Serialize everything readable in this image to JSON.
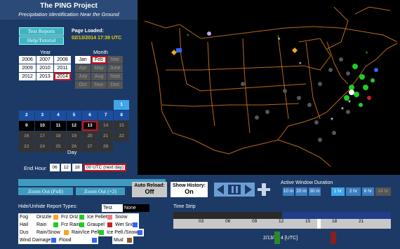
{
  "header": {
    "title": "The PING Project",
    "subtitle": "Precipitation Identification Near the Ground"
  },
  "links": {
    "text_reports": "Text Reports",
    "help": "Help/Tutorial"
  },
  "page_loaded": {
    "label": "Page Loaded:",
    "value": "02/13/2014 17:39 UTC"
  },
  "year_label": "Year",
  "month_label": "Month",
  "years": [
    "2006",
    "2007",
    "2008",
    "2009",
    "2010",
    "2011",
    "2012",
    "2013",
    "2014"
  ],
  "months": [
    "Jan",
    "Feb",
    "Mar",
    "Apr",
    "May",
    "June",
    "July",
    "Aug",
    "Sept",
    "Oct",
    "Nov",
    "Dec"
  ],
  "calendar": {
    "rows": [
      [
        "",
        "",
        "",
        "",
        "",
        "",
        "1"
      ],
      [
        "2",
        "3",
        "4",
        "5",
        "6",
        "7",
        "8"
      ],
      [
        "9",
        "10",
        "11",
        "12",
        "13",
        "14",
        "15"
      ],
      [
        "16",
        "17",
        "18",
        "19",
        "20",
        "21",
        "22"
      ],
      [
        "23",
        "24",
        "25",
        "26",
        "27",
        "28",
        ""
      ]
    ],
    "day_label": "Day"
  },
  "end_hour": {
    "label": "End Hour",
    "options": [
      "06",
      "12",
      "18"
    ],
    "selected": "00 UTC (next day)"
  },
  "zoom": {
    "full": "Zoom Out  (Full)",
    "x2": "Zoom Out  (×2)"
  },
  "auto_reload": {
    "label": "Auto Reload:",
    "value": "Off"
  },
  "show_history": {
    "label": "Show History:",
    "value": "On"
  },
  "active_window": {
    "label": "Active Window Duration",
    "options": [
      "10 m",
      "20 m",
      "30 m",
      "1 hr",
      "2 hr",
      "6 hr",
      "24 hr"
    ],
    "selected": "1 hr"
  },
  "legend": {
    "title": "Hide/Unhide Report Types:",
    "items": [
      {
        "label": "Test",
        "color": "#ffffff"
      },
      {
        "label": "None",
        "color": "#000000"
      },
      {
        "label": "Fog",
        "color": "#ffffff"
      },
      {
        "label": "Drizzle",
        "color": "#f5a623"
      },
      {
        "label": "Frz Driz",
        "color": "#22cc22"
      },
      {
        "label": "Ice Pellets",
        "color": "#f08080"
      },
      {
        "label": "Snow",
        "color": "#ffffff"
      },
      {
        "label": "Hail",
        "color": "#ffffff"
      },
      {
        "label": "Rain",
        "color": "#22cc22"
      },
      {
        "label": "Frz Rain",
        "color": "#22cc22"
      },
      {
        "label": "Graupel",
        "color": "#cc2222"
      },
      {
        "label": "Wet Snow",
        "color": "#3366ff"
      },
      {
        "label": "Dust",
        "color": "#ffffff"
      },
      {
        "label": "Rain/Snow",
        "color": "#f5a623"
      },
      {
        "label": "Rain/Ice Pell.",
        "color": "#22cc22"
      },
      {
        "label": "Ice Pell./Snow",
        "color": "#3366ff"
      },
      {
        "label": "Wind Damage",
        "color": "#3366ff"
      },
      {
        "label": "Flood",
        "color": "#3366ff"
      },
      {
        "label": "Mud",
        "color": "#8b5a2b"
      }
    ]
  },
  "time_strip": {
    "label": "Time Strip",
    "ticks": [
      "03",
      "06",
      "09",
      "12",
      "15",
      "18",
      "21"
    ],
    "date": "2/13/",
    "suffix": "4 [UTC]"
  }
}
